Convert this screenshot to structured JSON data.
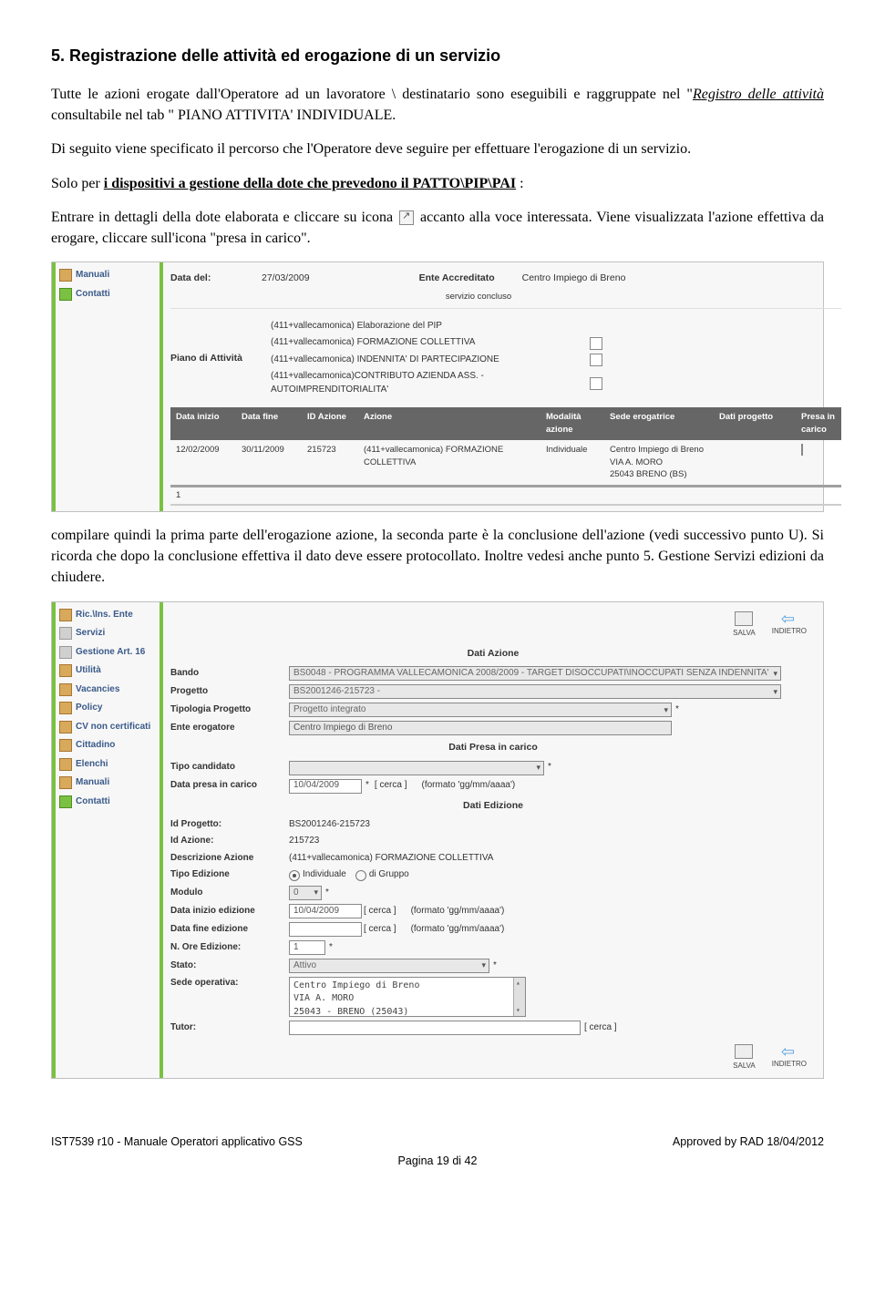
{
  "heading": "5. Registrazione delle attività  ed erogazione di un servizio",
  "p1_a": "Tutte le azioni erogate dall'Operatore ad un lavoratore \\ destinatario  sono eseguibili e raggruppate nel \"",
  "p1_reg_italic": "Registro delle attività",
  "p1_b": " consultabile nel tab \" PIANO ATTIVITA' INDIVIDUALE.",
  "p2": "Di seguito viene specificato il percorso che l'Operatore deve seguire per effettuare l'erogazione di un servizio.",
  "p3_a": "Solo per ",
  "p3_under": "i dispositivi a gestione della dote che prevedono il PATTO\\PIP\\PAI",
  "p3_b": " :",
  "p4_a": "Entrare in dettagli della dote elaborata e cliccare su icona ",
  "p4_b": " accanto alla voce interessata. Viene visualizzata l'azione effettiva da erogare, cliccare sull'icona \"presa in carico\".",
  "p5": "compilare quindi la prima parte dell'erogazione azione, la seconda parte è la conclusione dell'azione (vedi successivo punto U). Si ricorda che dopo la conclusione effettiva il dato deve essere protocollato. Inoltre vedesi anche punto 5. Gestione Servizi edizioni da chiudere.",
  "nav1": [
    "Manuali",
    "Contatti"
  ],
  "nav2": [
    "Ric.\\Ins. Ente",
    "Servizi",
    "Gestione Art. 16",
    "Utilità",
    "Vacancies",
    "Policy",
    "CV non certificati",
    "Cittadino",
    "Elenchi",
    "Manuali",
    "Contatti"
  ],
  "shot1": {
    "data_del_lbl": "Data del:",
    "data_del_val": "27/03/2009",
    "ente_lbl": "Ente Accreditato",
    "ente_val": "Centro Impiego di Breno",
    "piano_lbl": "Piano di Attività",
    "svc_concluso": "servizio concluso",
    "piano_items": [
      "(411+vallecamonica) Elaborazione del PIP",
      "(411+vallecamonica) FORMAZIONE COLLETTIVA",
      "(411+vallecamonica) INDENNITA' DI PARTECIPAZIONE",
      "(411+vallecamonica)CONTRIBUTO AZIENDA ASS. - AUTOIMPRENDITORIALITA'"
    ],
    "thead": [
      "Data inizio",
      "Data fine",
      "ID Azione",
      "Azione",
      "Modalità azione",
      "Sede erogatrice",
      "Dati progetto",
      "Presa in carico"
    ],
    "row": {
      "dini": "12/02/2009",
      "dfin": "30/11/2009",
      "idaz": "215723",
      "az": "(411+vallecamonica) FORMAZIONE COLLETTIVA",
      "mod": "Individuale",
      "sede": "Centro Impiego di Breno\nVIA A. MORO\n25043 BRENO (BS)"
    },
    "page": "1"
  },
  "shot2": {
    "btn_salva": "SALVA",
    "btn_indietro": "INDIETRO",
    "sec1": "Dati Azione",
    "bando_lbl": "Bando",
    "bando_val": "BS0048 - PROGRAMMA VALLECAMONICA 2008/2009 - TARGET DISOCCUPATI\\INOCCUPATI SENZA INDENNITA'",
    "progetto_lbl": "Progetto",
    "progetto_val": "BS2001246-215723 -",
    "tipprog_lbl": "Tipologia Progetto",
    "tipprog_val": "Progetto integrato",
    "enteerog_lbl": "Ente erogatore",
    "enteerog_val": "Centro Impiego di Breno",
    "sec2": "Dati Presa in carico",
    "tipocand_lbl": "Tipo candidato",
    "datapresa_lbl": "Data presa in carico",
    "datapresa_val": "10/04/2009",
    "cerca": "[ cerca ]",
    "formato": "(formato 'gg/mm/aaaa')",
    "sec3": "Dati Edizione",
    "idprog_lbl": "Id Progetto:",
    "idprog_val": "BS2001246-215723",
    "idaz_lbl": "Id Azione:",
    "idaz_val": "215723",
    "descaz_lbl": "Descrizione Azione",
    "descaz_val": "(411+vallecamonica) FORMAZIONE COLLETTIVA",
    "tipoed_lbl": "Tipo Edizione",
    "tipoed_opt1": "Individuale",
    "tipoed_opt2": "di Gruppo",
    "modulo_lbl": "Modulo",
    "modulo_val": "0",
    "dataied_lbl": "Data inizio edizione",
    "dataied_val": "10/04/2009",
    "datafed_lbl": "Data fine edizione",
    "nore_lbl": "N. Ore Edizione:",
    "nore_val": "1",
    "stato_lbl": "Stato:",
    "stato_val": "Attivo",
    "sedeop_lbl": "Sede operativa:",
    "sedeop_val": "Centro Impiego di Breno\nVIA A. MORO\n25043 - BRENO (25043)",
    "tutor_lbl": "Tutor:"
  },
  "footer": {
    "left": "IST7539 r10 -  Manuale Operatori applicativo GSS",
    "right": "Approved by RAD 18/04/2012",
    "page": "Pagina 19 di 42"
  }
}
